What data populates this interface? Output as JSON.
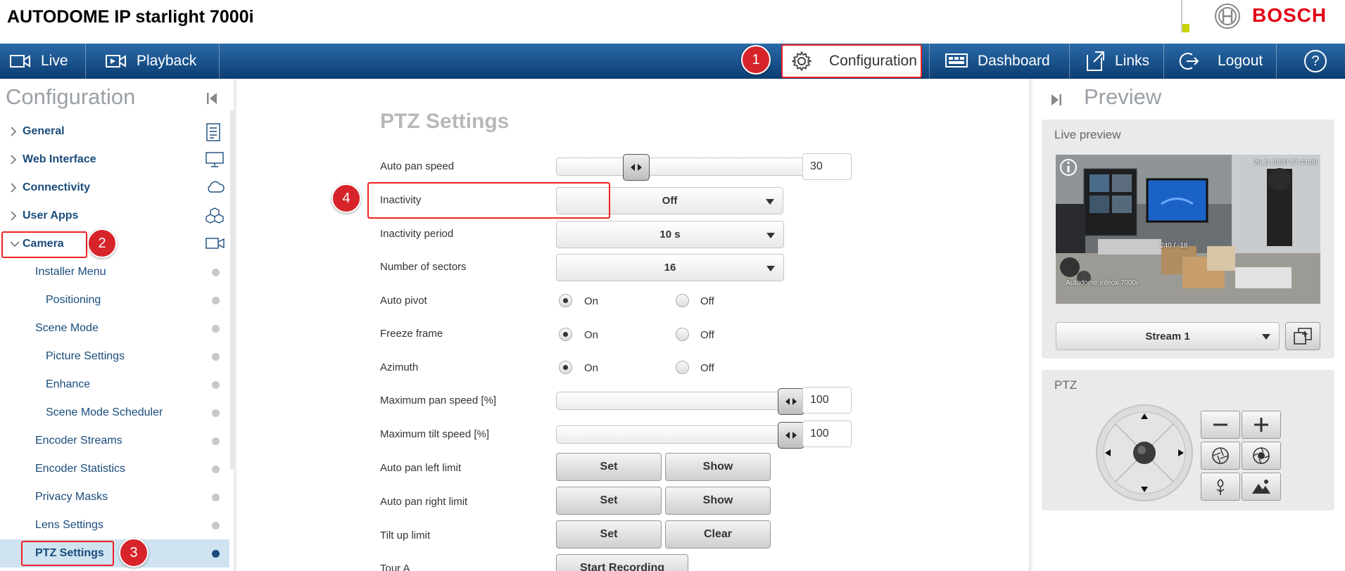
{
  "header": {
    "title": "AUTODOME IP starlight 7000i",
    "brand": "BOSCH",
    "signal_level": 0.25
  },
  "nav": {
    "live": "Live",
    "playback": "Playback",
    "configuration": "Configuration",
    "dashboard": "Dashboard",
    "links": "Links",
    "logout": "Logout",
    "help": "?"
  },
  "badges": [
    "1",
    "2",
    "3",
    "4"
  ],
  "sidebar": {
    "title": "Configuration",
    "items": [
      {
        "label": "General",
        "icon": "document-list-icon"
      },
      {
        "label": "Web Interface",
        "icon": "monitor-icon"
      },
      {
        "label": "Connectivity",
        "icon": "cloud-icon"
      },
      {
        "label": "User Apps",
        "icon": "cubes-icon"
      },
      {
        "label": "Camera",
        "icon": "video-camera-icon"
      },
      {
        "label": "Installer Menu"
      },
      {
        "label": "Positioning"
      },
      {
        "label": "Scene Mode"
      },
      {
        "label": "Picture Settings"
      },
      {
        "label": "Enhance"
      },
      {
        "label": "Scene Mode Scheduler"
      },
      {
        "label": "Encoder Streams"
      },
      {
        "label": "Encoder Statistics"
      },
      {
        "label": "Privacy Masks"
      },
      {
        "label": "Lens Settings"
      },
      {
        "label": "PTZ Settings"
      }
    ]
  },
  "main": {
    "title": "PTZ Settings",
    "auto_pan_speed": {
      "label": "Auto pan speed",
      "value": "30",
      "level": 0.3
    },
    "inactivity": {
      "label": "Inactivity",
      "value": "Off"
    },
    "inactivity_period": {
      "label": "Inactivity period",
      "value": "10 s"
    },
    "number_of_sectors": {
      "label": "Number of sectors",
      "value": "16"
    },
    "auto_pivot": {
      "label": "Auto pivot",
      "on": "On",
      "off": "Off",
      "selected": "On"
    },
    "freeze_frame": {
      "label": "Freeze frame",
      "on": "On",
      "off": "Off",
      "selected": "On"
    },
    "azimuth": {
      "label": "Azimuth",
      "on": "On",
      "off": "Off",
      "selected": "On"
    },
    "max_pan_speed": {
      "label": "Maximum pan speed [%]",
      "value": "100",
      "level": 1.0
    },
    "max_tilt_speed": {
      "label": "Maximum tilt speed [%]",
      "value": "100",
      "level": 1.0
    },
    "auto_pan_left_limit": {
      "label": "Auto pan left limit",
      "set": "Set",
      "show": "Show"
    },
    "auto_pan_right_limit": {
      "label": "Auto pan right limit",
      "set": "Set",
      "show": "Show"
    },
    "tilt_up_limit": {
      "label": "Tilt up limit",
      "set": "Set",
      "clear": "Clear"
    },
    "tour_a": {
      "label": "Tour A",
      "start": "Start Recording"
    }
  },
  "preview": {
    "title": "Preview",
    "live_preview": "Live preview",
    "overlay_timestamp": "26.11.2020 17:44:09",
    "overlay_position": "240 / -18",
    "overlay_name": "Autodome inteox 7000i",
    "stream": "Stream 1",
    "ptz_title": "PTZ"
  },
  "colors": {
    "brand_red": "#e20015",
    "nav_blue": "#0c3d72",
    "highlight_red": "#e22222",
    "badge_red": "#d6242a"
  }
}
